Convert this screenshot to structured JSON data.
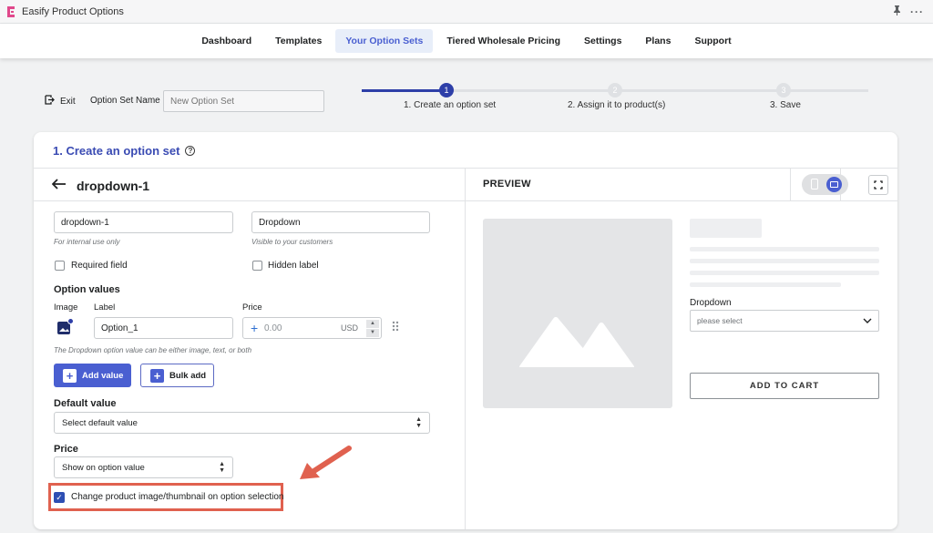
{
  "app": {
    "title": "Easify Product Options"
  },
  "nav": {
    "items": [
      "Dashboard",
      "Templates",
      "Your Option Sets",
      "Tiered Wholesale Pricing",
      "Settings",
      "Plans",
      "Support"
    ],
    "active": "Your Option Sets"
  },
  "header": {
    "exit_label": "Exit",
    "option_set_name_label": "Option Set Name",
    "option_set_name_placeholder": "New Option Set"
  },
  "stepper": {
    "steps": [
      {
        "number": "1",
        "label": "1. Create an option set",
        "active": true
      },
      {
        "number": "2",
        "label": "2. Assign it to product(s)",
        "active": false
      },
      {
        "number": "3",
        "label": "3. Save",
        "active": false
      }
    ]
  },
  "card": {
    "title": "1. Create an option set",
    "field_title": "dropdown-1",
    "internal_name": {
      "value": "dropdown-1",
      "hint": "For internal use only"
    },
    "public_label": {
      "value": "Dropdown",
      "hint": "Visible to your customers"
    },
    "required_field": "Required field",
    "hidden_label": "Hidden label",
    "option_values": {
      "heading": "Option values",
      "col_image": "Image",
      "col_label": "Label",
      "col_price": "Price",
      "row_label": "Option_1",
      "price_placeholder": "0.00",
      "currency": "USD",
      "note": "The Dropdown option value can be either image, text, or both"
    },
    "add_value": "Add value",
    "bulk_add": "Bulk add",
    "default_value": {
      "heading": "Default value",
      "selected": "Select default value"
    },
    "price": {
      "heading": "Price",
      "selected": "Show on option value"
    },
    "change_image_checkbox": {
      "label": "Change product image/thumbnail on option selection",
      "checked": true
    }
  },
  "preview": {
    "title": "PREVIEW",
    "dropdown_label": "Dropdown",
    "dropdown_placeholder": "please select",
    "add_to_cart": "ADD TO CART"
  },
  "colors": {
    "accent": "#4a5fd1",
    "highlight": "#e0614f",
    "title": "#3a4bb3"
  },
  "icons": [
    "app-logo-icon",
    "pin-icon",
    "more-icon",
    "exit-icon",
    "help-icon",
    "back-arrow-icon",
    "image-icon",
    "plus-icon",
    "drag-handle-icon",
    "mobile-icon",
    "desktop-icon",
    "fullscreen-icon",
    "chevron-down-icon",
    "image-placeholder-icon",
    "annotation-arrow-icon"
  ]
}
